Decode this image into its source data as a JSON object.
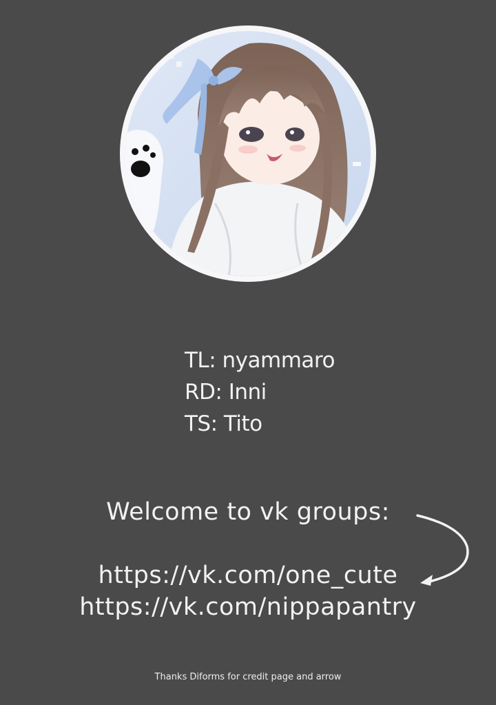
{
  "credits": {
    "tl": "TL: nyammaro",
    "rd": "RD: Inni",
    "ts": "TS: Tito"
  },
  "welcome": {
    "text": "Welcome to vk groups:",
    "links": [
      "https://vk.com/one_cute",
      "https://vk.com/nippapantry"
    ]
  },
  "footer": {
    "text": "Thanks Diforms for credit page and arrow"
  },
  "colors": {
    "background": "#4a4a4a",
    "text": "#f2f2f2",
    "avatar_ring": "#f7f7f9"
  }
}
